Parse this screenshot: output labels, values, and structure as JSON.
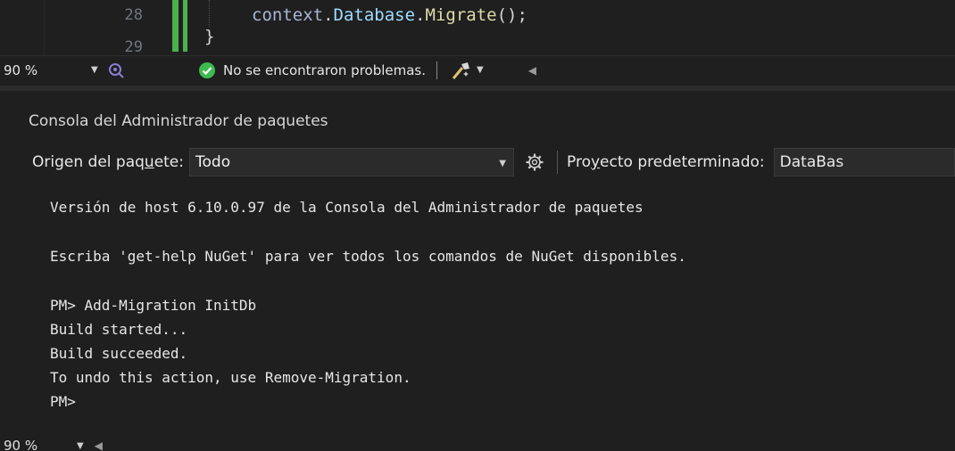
{
  "editor": {
    "lines": [
      {
        "number": "28",
        "code_parts": [
          "context",
          ".",
          "Database",
          ".",
          "Migrate",
          "();"
        ]
      },
      {
        "number": "29",
        "code_parts": [
          "}"
        ]
      }
    ]
  },
  "editor_status": {
    "zoom": "90 %",
    "message": "No se encontraron problemas."
  },
  "package_console": {
    "title": "Consola del Administrador de paquetes",
    "source_label_pre": "Origen del paq",
    "source_label_u": "u",
    "source_label_post": "ete:",
    "source_value": "Todo",
    "project_label_pre": "Pro",
    "project_label_u": "y",
    "project_label_post": "ecto predeterminado:",
    "project_value": "DataBas",
    "output_lines": [
      "Versión de host 6.10.0.97 de la Consola del Administrador de paquetes",
      "Escriba 'get-help NuGet' para ver todos los comandos de NuGet disponibles.",
      "PM> Add-Migration InitDb",
      "Build started...",
      "Build succeeded.",
      "To undo this action, use Remove-Migration.",
      "PM>"
    ],
    "zoom": "90 %"
  },
  "colors": {
    "background": "#1f1f1f",
    "change_bar": "#4cb04c",
    "check": "#3fb950"
  },
  "icons": [
    "health-icon",
    "check-circle-icon",
    "cleanup-brush-icon",
    "gear-icon",
    "chevron-down-icon",
    "chevron-left-icon"
  ]
}
